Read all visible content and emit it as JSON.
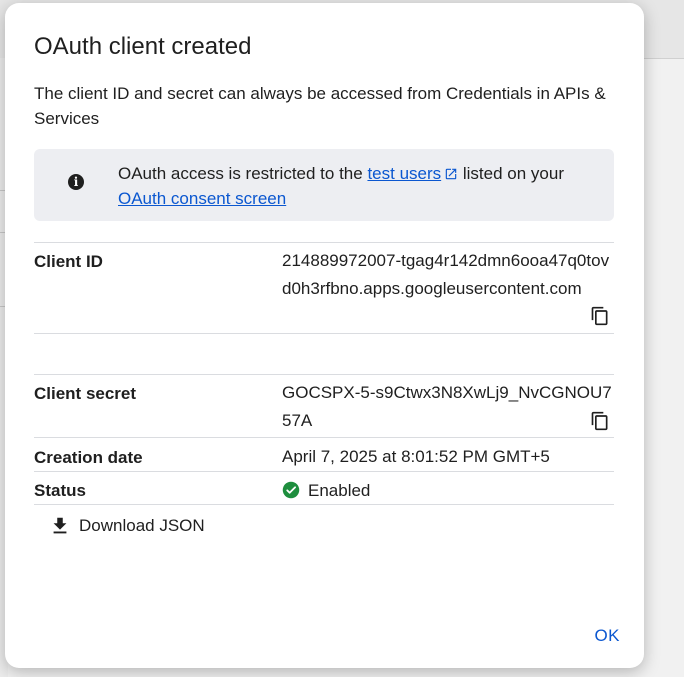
{
  "dialog": {
    "title": "OAuth client created",
    "description": "The client ID and secret can always be accessed from Credentials in APIs & Services"
  },
  "info": {
    "text_before": "OAuth access is restricted to the ",
    "link1": "test users",
    "text_middle": " listed on your ",
    "link2": "OAuth consent screen",
    "icon": "info-icon"
  },
  "details": {
    "client_id_label": "Client ID",
    "client_id_value": "214889972007-tgag4r142dmn6ooa47q0tovd0h3rfbno.apps.googleusercontent.com",
    "client_secret_label": "Client secret",
    "client_secret_value": "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",
    "creation_date_label": "Creation date",
    "creation_date_value": "April 7, 2025 at 8:01:52 PM GMT+5",
    "status_label": "Status",
    "status_value": "Enabled"
  },
  "actions": {
    "download_label": "Download JSON",
    "ok_label": "OK"
  },
  "colors": {
    "accent": "#0b57d0",
    "status_green": "#1e8e3e",
    "info_bg": "#edeef2"
  }
}
